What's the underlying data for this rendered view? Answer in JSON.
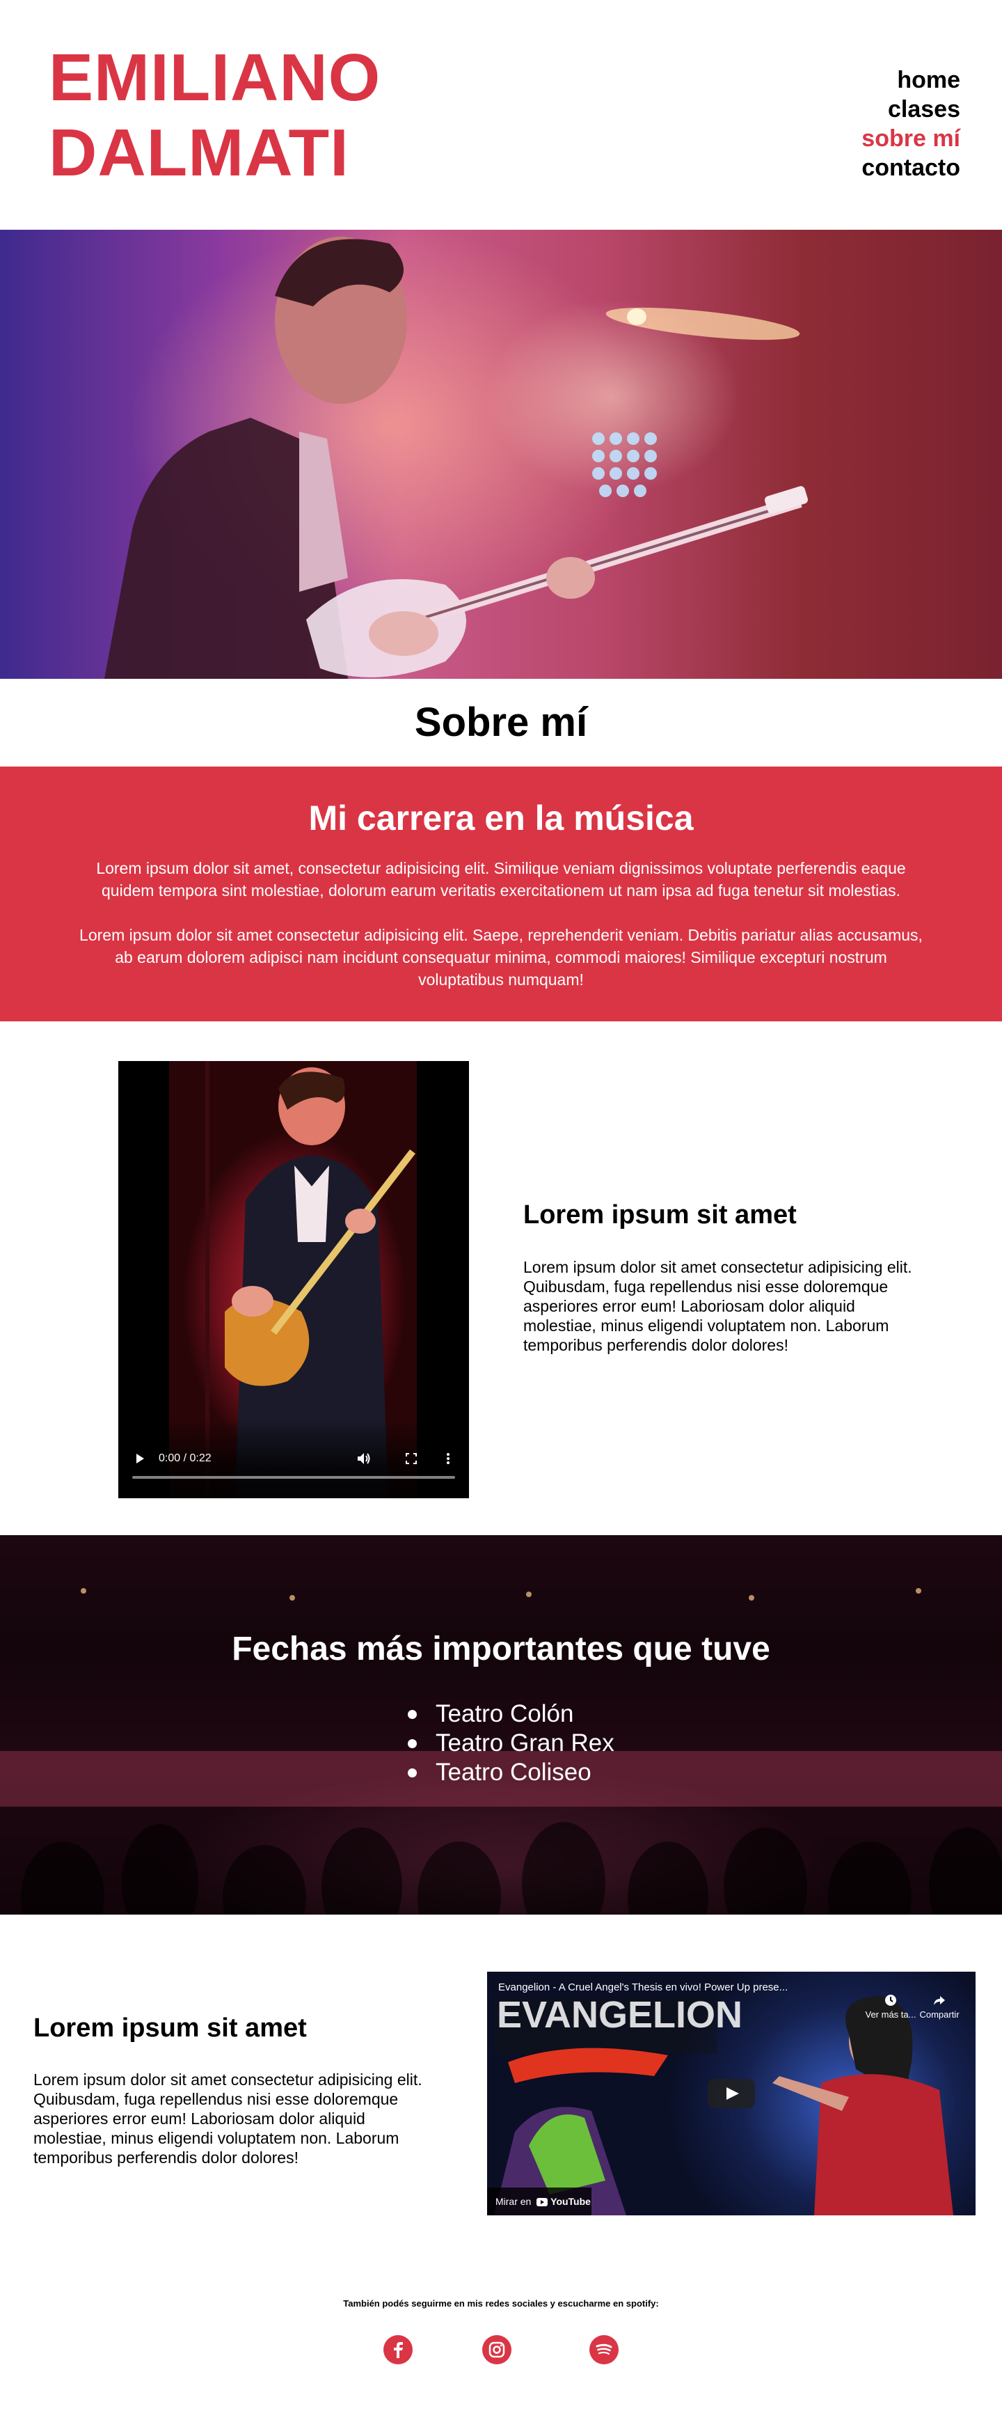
{
  "site": {
    "brand_line1": "EMILIANO",
    "brand_line2": "DALMATI",
    "accent_color": "#da3545"
  },
  "nav": {
    "items": [
      {
        "label": "home",
        "active": false
      },
      {
        "label": "clases",
        "active": false
      },
      {
        "label": "sobre mí",
        "active": true
      },
      {
        "label": "contacto",
        "active": false
      }
    ]
  },
  "hero": {
    "image": "guitarist-on-stage-photo"
  },
  "page_title": "Sobre mí",
  "career": {
    "title": "Mi carrera en la música",
    "p1": "Lorem ipsum dolor sit amet, consectetur adipisicing elit. Similique veniam dignissimos voluptate perferendis eaque quidem tempora sint molestiae, dolorum earum veritatis exercitationem ut nam ipsa ad fuga tenetur sit molestias.",
    "p2": "Lorem ipsum dolor sit amet consectetur adipisicing elit. Saepe, reprehenderit veniam. Debitis pariatur alias accusamus, ab earum dolorem adipisci nam incidunt consequatur minima, commodi maiores! Similique excepturi nostrum voluptatibus numquam!"
  },
  "video1": {
    "time": "0:00 / 0:22",
    "play_icon": "play-icon",
    "volume_icon": "volume-icon",
    "fullscreen_icon": "fullscreen-icon",
    "more_icon": "more-vert-icon"
  },
  "block1": {
    "title": "Lorem ipsum sit amet",
    "text": "Lorem ipsum dolor sit amet consectetur adipisicing elit. Quibusdam, fuga repellendus nisi esse doloremque asperiores error eum! Laboriosam dolor aliquid molestiae, minus eligendi voluptatem non. Laborum temporibus perferendis dolor dolores!"
  },
  "fechas": {
    "title": "Fechas más importantes que tuve",
    "items": [
      "Teatro Colón",
      "Teatro Gran Rex",
      "Teatro Coliseo"
    ]
  },
  "block2": {
    "title": "Lorem ipsum sit amet",
    "text": "Lorem ipsum dolor sit amet consectetur adipisicing elit. Quibusdam, fuga repellendus nisi esse doloremque asperiores error eum! Laboriosam dolor aliquid molestiae, minus eligendi voluptatem non. Laborum temporibus perferendis dolor dolores!"
  },
  "youtube": {
    "title": "Evangelion - A Cruel Angel's Thesis en vivo! Power Up prese...",
    "watch_later": "Ver más ta...",
    "share": "Compartir",
    "watch_on": "Mirar en",
    "youtube_label": "YouTube"
  },
  "footer": {
    "text": "También podés seguirme en mis redes sociales y escucharme en spotify:",
    "icons": [
      "facebook-icon",
      "instagram-icon",
      "spotify-icon"
    ]
  }
}
